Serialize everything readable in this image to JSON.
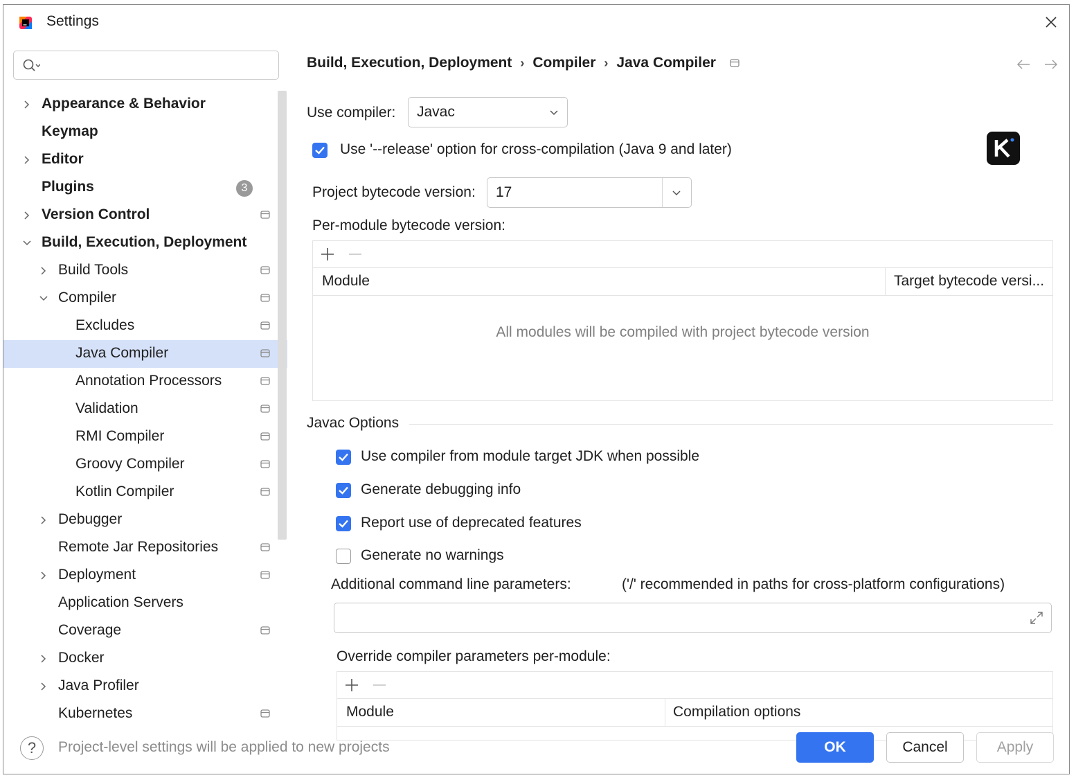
{
  "window": {
    "title": "Settings"
  },
  "search": {
    "placeholder": ""
  },
  "sidebar": {
    "items": [
      {
        "label": "Appearance & Behavior",
        "bold": true
      },
      {
        "label": "Keymap",
        "bold": true
      },
      {
        "label": "Editor",
        "bold": true
      },
      {
        "label": "Plugins",
        "bold": true,
        "badge": "3"
      },
      {
        "label": "Version Control",
        "bold": true
      },
      {
        "label": "Build, Execution, Deployment",
        "bold": true
      },
      {
        "label": "Build Tools"
      },
      {
        "label": "Compiler"
      },
      {
        "label": "Excludes"
      },
      {
        "label": "Java Compiler",
        "selected": true
      },
      {
        "label": "Annotation Processors"
      },
      {
        "label": "Validation"
      },
      {
        "label": "RMI Compiler"
      },
      {
        "label": "Groovy Compiler"
      },
      {
        "label": "Kotlin Compiler"
      },
      {
        "label": "Debugger"
      },
      {
        "label": "Remote Jar Repositories"
      },
      {
        "label": "Deployment"
      },
      {
        "label": "Application Servers"
      },
      {
        "label": "Coverage"
      },
      {
        "label": "Docker"
      },
      {
        "label": "Java Profiler"
      },
      {
        "label": "Kubernetes"
      }
    ]
  },
  "breadcrumb": [
    "Build, Execution, Deployment",
    "Compiler",
    "Java Compiler"
  ],
  "breadcrumb_sep": "›",
  "compiler": {
    "use_compiler_label": "Use compiler:",
    "use_compiler_value": "Javac",
    "release_option_label": "Use '--release' option for cross-compilation (Java 9 and later)",
    "release_option_checked": true,
    "bytecode_label": "Project bytecode version:",
    "bytecode_value": "17",
    "per_module_label": "Per-module bytecode version:",
    "per_module_table": {
      "columns": [
        "Module",
        "Target bytecode versi..."
      ],
      "empty_text": "All modules will be compiled with project bytecode version"
    }
  },
  "javac": {
    "section_title": "Javac Options",
    "options": [
      {
        "label": "Use compiler from module target JDK when possible",
        "checked": true
      },
      {
        "label": "Generate debugging info",
        "checked": true
      },
      {
        "label": "Report use of deprecated features",
        "checked": true
      },
      {
        "label": "Generate no warnings",
        "checked": false
      }
    ],
    "additional_params_label": "Additional command line parameters:",
    "additional_params_hint": "('/' recommended in paths for cross-platform configurations)",
    "additional_params_value": "",
    "override_label": "Override compiler parameters per-module:",
    "override_table": {
      "columns": [
        "Module",
        "Compilation options"
      ]
    }
  },
  "footer": {
    "help": "?",
    "note": "Project-level settings will be applied to new projects",
    "ok": "OK",
    "cancel": "Cancel",
    "apply": "Apply"
  },
  "colors": {
    "accent": "#3574f0",
    "selection": "#d5e1f8"
  }
}
